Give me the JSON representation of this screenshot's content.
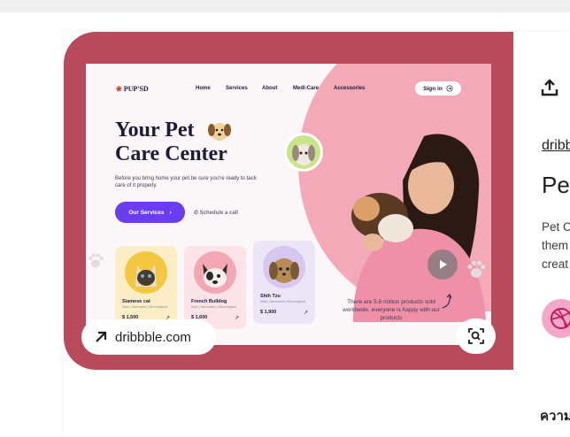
{
  "mockup": {
    "logo": "PUP'SD",
    "nav": [
      "Home",
      "Services",
      "About",
      "Medi-Care",
      "Accessories"
    ],
    "signin_label": "Sign in",
    "hero_title_line1": "Your Pet",
    "hero_title_line2": "Care Center",
    "hero_sub": "Before you bring home your pet.be sure you're ready to tack care of it properly.",
    "services_label": "Our Services",
    "schedule_label": "Schedule a call",
    "stat_text": "There are 5.8 million products sold worldwide, everyone is happy with our products",
    "products": [
      {
        "name": "Siamese cat",
        "meta": "Male | Vaccinated | Microchipped",
        "price": "$ 1,500",
        "bg": "#fbeec7",
        "circle": "#f5c842"
      },
      {
        "name": "French Bulldog",
        "meta": "Male | Vaccinated | Microchipped",
        "price": "$ 1,600",
        "bg": "#fbe3e8",
        "circle": "#f3a7b5"
      },
      {
        "name": "Shih Tzu",
        "meta": "Male | Vaccinated | Microchipped",
        "price": "$ 1,900",
        "bg": "#ece4f7",
        "circle": "#d7c7f0"
      }
    ]
  },
  "overlay": {
    "source_label": "dribbble.com"
  },
  "side_panel": {
    "link_text": "dribb",
    "title_text": "Pe",
    "desc_lines": [
      "Pet C",
      "them",
      "creat"
    ],
    "bottom_text": "ความ"
  },
  "colors": {
    "hero_frame": "#b94a5c",
    "accent": "#6a3df0",
    "blob": "#f3a9b7"
  },
  "icons": {
    "share": "share-icon",
    "lens": "visual-search-icon",
    "arrow": "arrow-up-right-icon",
    "play": "play-icon",
    "dribbble": "dribbble-ball-icon"
  }
}
